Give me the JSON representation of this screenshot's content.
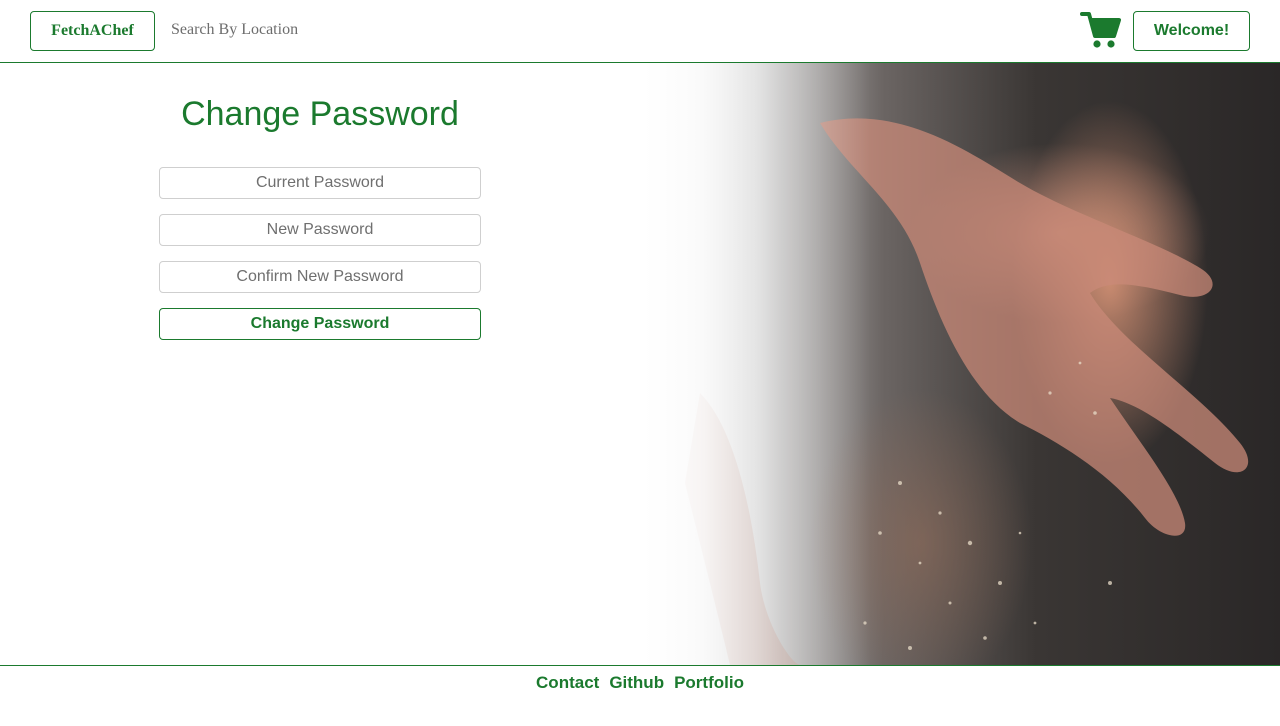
{
  "header": {
    "brand_label": "FetchAChef",
    "search_placeholder": "Search By Location",
    "cart_icon": "shopping-cart-icon",
    "welcome_label": "Welcome!"
  },
  "main": {
    "title": "Change Password",
    "fields": {
      "current_placeholder": "Current Password",
      "new_placeholder": "New Password",
      "confirm_placeholder": "Confirm New Password"
    },
    "submit_label": "Change Password"
  },
  "footer": {
    "links": [
      "Contact",
      "Github",
      "Portfolio"
    ]
  },
  "colors": {
    "accent": "#1b7a2e",
    "field_border": "#cfcfcf"
  }
}
